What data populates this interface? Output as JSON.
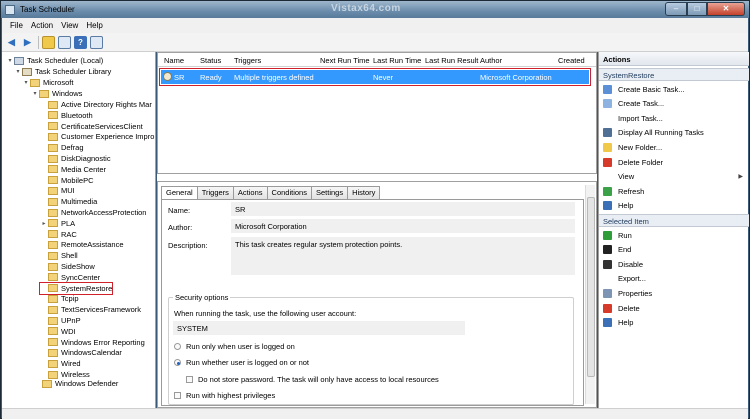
{
  "window": {
    "title": "Task Scheduler",
    "watermark": "Vistax64.com"
  },
  "menu": [
    "File",
    "Action",
    "View",
    "Help"
  ],
  "tree": {
    "root": "Task Scheduler (Local)",
    "library": "Task Scheduler Library",
    "microsoft": "Microsoft",
    "windows": "Windows",
    "items": [
      "Active Directory Rights Mar",
      "Bluetooth",
      "CertificateServicesClient",
      "Customer Experience Impro",
      "Defrag",
      "DiskDiagnostic",
      "Media Center",
      "MobilePC",
      "MUI",
      "Multimedia",
      "NetworkAccessProtection",
      "PLA",
      "RAC",
      "RemoteAssistance",
      "Shell",
      "SideShow",
      "SyncCenter",
      "SystemRestore",
      "Tcpip",
      "TextServicesFramework",
      "UPnP",
      "WDI",
      "Windows Error Reporting",
      "WindowsCalendar",
      "Wired",
      "Wireless"
    ],
    "defender": "Windows Defender",
    "selected": "SystemRestore"
  },
  "task_table": {
    "columns": [
      "Name",
      "Status",
      "Triggers",
      "Next Run Time",
      "Last Run Time",
      "Last Run Result",
      "Author",
      "Created"
    ],
    "rows": [
      {
        "name": "SR",
        "status": "Ready",
        "triggers": "Multiple triggers defined",
        "next_run": "",
        "last_run": "Never",
        "last_result": "",
        "author": "Microsoft Corporation",
        "created": ""
      }
    ]
  },
  "details": {
    "tabs": [
      "General",
      "Triggers",
      "Actions",
      "Conditions",
      "Settings",
      "History"
    ],
    "name_label": "Name:",
    "name_value": "SR",
    "author_label": "Author:",
    "author_value": "Microsoft Corporation",
    "description_label": "Description:",
    "description_value": "This task creates regular system protection points.",
    "security_title": "Security options",
    "user_account_label": "When running the task, use the following user account:",
    "user_account_value": "SYSTEM",
    "opt_logged_on": "Run only when user is logged on",
    "opt_logged_on_or_not": "Run whether user is logged on or not",
    "opt_no_store_password": "Do not store password.  The task will only have access to local resources",
    "opt_highest_privileges": "Run with highest privileges"
  },
  "actions": {
    "header": "Actions",
    "section1": "SystemRestore",
    "items1": [
      "Create Basic Task...",
      "Create Task...",
      "Import Task...",
      "Display All Running Tasks",
      "New Folder...",
      "Delete Folder",
      "View",
      "Refresh",
      "Help"
    ],
    "section2": "Selected Item",
    "items2": [
      "Run",
      "End",
      "Disable",
      "Export...",
      "Properties",
      "Delete",
      "Help"
    ]
  },
  "colors": {
    "selection": "#3399ff",
    "highlight_border": "#d0202a",
    "titlebar": "#6b8cab"
  }
}
